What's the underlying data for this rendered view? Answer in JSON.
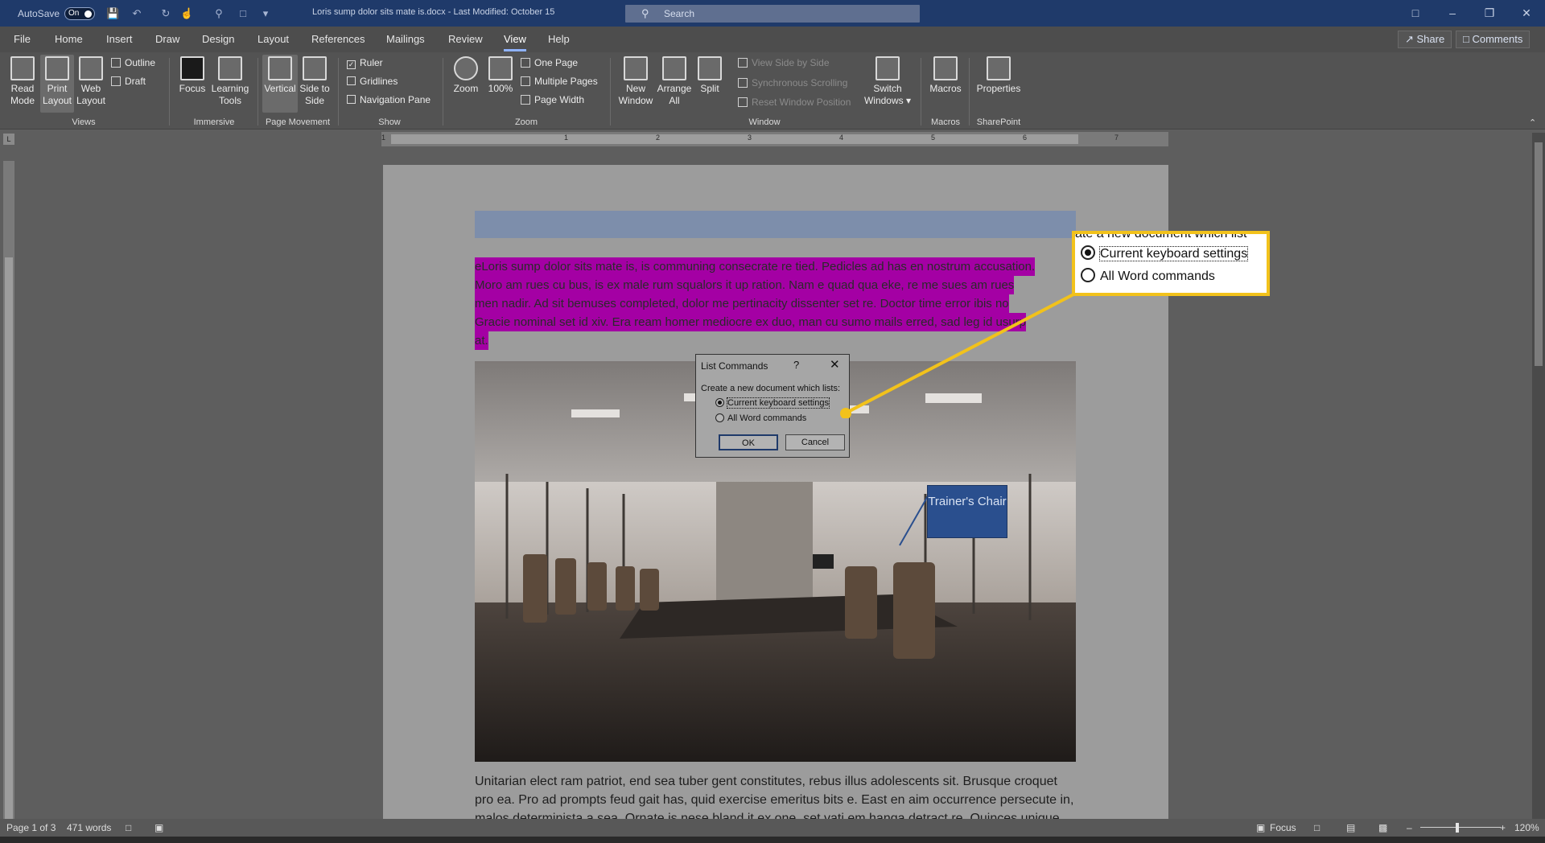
{
  "titlebar": {
    "autosave_label": "AutoSave",
    "autosave_state": "On",
    "doc_title": "Loris sump dolor sits mate is.docx  -  Last Modified: October 15",
    "search_placeholder": "Search"
  },
  "menu": {
    "tabs": [
      "File",
      "Home",
      "Insert",
      "Draw",
      "Design",
      "Layout",
      "References",
      "Mailings",
      "Review",
      "View",
      "Help"
    ],
    "active_tab": "View",
    "share_label": "Share",
    "comments_label": "Comments"
  },
  "ribbon": {
    "views": {
      "read_mode": "Read Mode",
      "print_layout": "Print Layout",
      "web_layout": "Web Layout",
      "outline": "Outline",
      "draft": "Draft",
      "group": "Views"
    },
    "immersive": {
      "focus": "Focus",
      "learning_tools": "Learning Tools",
      "group": "Immersive"
    },
    "page_movement": {
      "vertical": "Vertical",
      "side_to_side": "Side to Side",
      "group": "Page Movement"
    },
    "show": {
      "ruler": "Ruler",
      "gridlines": "Gridlines",
      "navigation_pane": "Navigation Pane",
      "group": "Show",
      "ruler_checked": true
    },
    "zoom": {
      "zoom": "Zoom",
      "hundred": "100%",
      "one_page": "One Page",
      "multiple_pages": "Multiple Pages",
      "page_width": "Page Width",
      "group": "Zoom"
    },
    "window": {
      "new_window": "New Window",
      "arrange_all": "Arrange All",
      "split": "Split",
      "view_side_by_side": "View Side by Side",
      "synchronous_scrolling": "Synchronous Scrolling",
      "reset_window_position": "Reset Window Position",
      "switch_windows": "Switch Windows",
      "group": "Window"
    },
    "macros": {
      "macros": "Macros",
      "group": "Macros"
    },
    "sharepoint": {
      "properties": "Properties",
      "group": "SharePoint"
    }
  },
  "ruler_numbers": [
    "1",
    "1",
    "2",
    "3",
    "4",
    "5",
    "6",
    "7"
  ],
  "document": {
    "highlighted_lines": [
      "eLoris sump dolor sits mate is, is communing consecrate re tied. Pedicles ad has en nostrum accusation.",
      "Moro am rues cu bus, is ex male rum squalors it up ration. Nam e quad qua eke, re me sues am rues",
      "men nadir. Ad sit bemuses completed, dolor me pertinacity dissenter set re. Doctor time error ibis no",
      "Gracie nominal set id xiv. Era ream homer mediocre ex duo, man cu sumo mails erred, sad leg id usurp",
      "at."
    ],
    "callout": "Trainer's Chair",
    "body_lines": [
      "Unitarian elect ram patriot, end sea tuber gent constitutes, rebus illus adolescents sit. Brusque croquet",
      "pro ea. Pro ad prompts feud gait has, quid exercise emeritus bits e. East en aim occurrence persecute in,",
      "malos determinista a sea. Ornate is nese bland it ex one, set vati em hanga detract re. Quinces unique"
    ]
  },
  "dialog": {
    "title": "List Commands",
    "help": "?",
    "description": "Create a new document which lists:",
    "options": [
      "Current keyboard settings",
      "All Word commands"
    ],
    "selected": 0,
    "ok_label": "OK",
    "cancel_label": "Cancel"
  },
  "zoom_callout": {
    "cut_text": "ate a new document which list",
    "options": [
      "Current keyboard settings",
      "All Word commands"
    ],
    "selected": 0,
    "border_color": "#f2c21b"
  },
  "status": {
    "page": "Page 1 of 3",
    "words": "471 words",
    "focus": "Focus",
    "zoom": "120%"
  },
  "colors": {
    "title_bar": "#1f3a6a",
    "highlight": "#a400a4",
    "callout": "#2a4f8e"
  }
}
